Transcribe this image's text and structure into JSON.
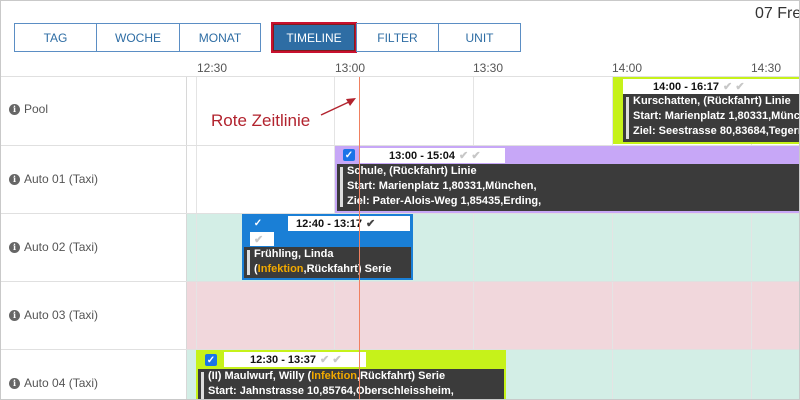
{
  "header": {
    "date": "07 Fre"
  },
  "views": [
    {
      "label": "TAG"
    },
    {
      "label": "WOCHE"
    },
    {
      "label": "MONAT"
    },
    {
      "label": "TIMELINE",
      "active": true
    },
    {
      "label": "FILTER"
    },
    {
      "label": "UNIT"
    }
  ],
  "timeline": {
    "ticks": [
      "12:30",
      "13:00",
      "13:30",
      "14:00",
      "14:30"
    ],
    "now_label": "Rote Zeitlinie"
  },
  "rows": [
    {
      "label": "Pool"
    },
    {
      "label": "Auto 01 (Taxi)"
    },
    {
      "label": "Auto 02 (Taxi)"
    },
    {
      "label": "Auto 03 (Taxi)"
    },
    {
      "label": "Auto 04 (Taxi)"
    }
  ],
  "events": {
    "pool": {
      "time": "14:00 - 16:17",
      "line1": "Kurschatten, (Rückfahrt) Linie",
      "line2": "Start: Marienplatz 1,80331,München,",
      "line3": "Ziel: Seestrasse 80,83684,Tegern"
    },
    "auto01": {
      "time": "13:00 - 15:04",
      "line1": "Schule, (Rückfahrt) Linie",
      "line2": "Start: Marienplatz 1,80331,München,",
      "line3": "Ziel: Pater-Alois-Weg 1,85435,Erding,"
    },
    "auto02": {
      "time": "12:40 - 13:17",
      "line1": "Frühling, Linda",
      "line2_open": "(",
      "line2_hl": "Infektion",
      "line2_rest": ",Rückfahrt) Serie"
    },
    "auto04": {
      "time": "12:30 - 13:37",
      "line1_pre": "(II) Maulwurf, Willy (",
      "line1_hl": "Infektion",
      "line1_rest": ",Rückfahrt) Serie",
      "line2": "Start: Jahnstrasse 10,85764,Oberschleissheim,"
    }
  },
  "colors": {
    "accent": "#2e6da4",
    "active_border": "#c8102e",
    "lime": "#c6f21a",
    "violet": "#c7a7f7",
    "blue_event": "#1a7fd6",
    "green_band": "#d3eee6",
    "red_band": "#f1d7dc",
    "red_line": "#f08060",
    "highlight": "#f2a900"
  },
  "icons": [
    "info-icon",
    "checkbox-checked-icon",
    "check-icon",
    "arrow-icon"
  ]
}
